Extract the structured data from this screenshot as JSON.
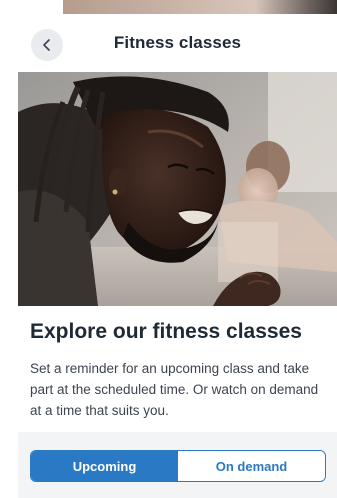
{
  "header": {
    "title": "Fitness classes",
    "back_icon": "chevron-left-icon"
  },
  "hero": {
    "image": "man-doing-plank-exercise-photo"
  },
  "intro": {
    "title": "Explore our fitness classes",
    "description": "Set a reminder for an upcoming class and take part at the scheduled time. Or watch on demand at a time that suits you."
  },
  "tabs": {
    "items": [
      {
        "label": "Upcoming",
        "selected": true
      },
      {
        "label": "On demand",
        "selected": false
      }
    ]
  },
  "colors": {
    "accent": "#2a79c4",
    "title_text": "#1f2a37",
    "body_text": "#3d4450",
    "card_background": "#f3f4f6",
    "back_button_background": "#e9ebee"
  }
}
